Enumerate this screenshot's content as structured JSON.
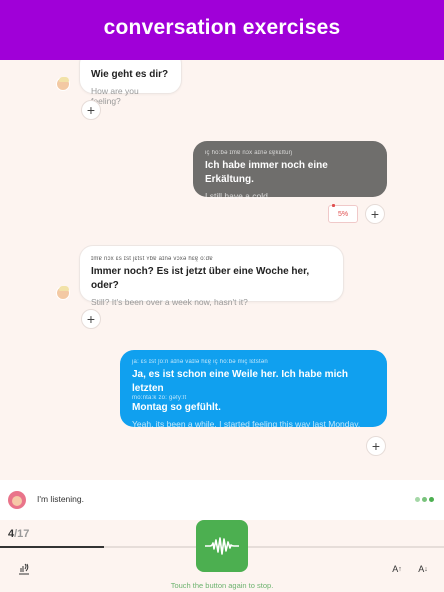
{
  "header": {
    "title": "conversation exercises"
  },
  "messages": [
    {
      "role": "partner",
      "ipa": "",
      "de": "Wie geht es dir?",
      "en": "How are you feeling?"
    },
    {
      "role": "user",
      "ipa": "iç   ho:bə       ɪmɐ       nɔx      aɪnə       ɛɐ̯kɛltuŋ",
      "de": "Ich habe immer noch eine Erkältung.",
      "en": "I still have a cold.",
      "score": "5%"
    },
    {
      "role": "partner",
      "ipa": "ɪmɐ       nɔx    ɛs   ɪst   jɛtst    ʏbɐ    aɪnə     vɔxə     hɛɐ̯      o:dɐ",
      "de": "Immer noch? Es ist jetzt über eine Woche her, oder?",
      "en": "Still? It's been over a week now, hasn't it?"
    },
    {
      "role": "current",
      "ipa": "ja:    ɛs    ɪst     ʃo:n     aɪnə    vaɪlə    hɛɐ̯   iç    ho:bə    miç      lɛtstən",
      "de_line1": "Ja, es ist schon eine Weile her. Ich habe mich letzten",
      "de_line2": "Montag so gefühlt.",
      "ipa2": "mo:nta:k   zo:     gəfy:lt",
      "en": "Yeah, its been a while. I started feeling this way last Monday."
    }
  ],
  "icons": {
    "add": "+",
    "add_name": "add-icon"
  },
  "status": {
    "listening": "I'm listening."
  },
  "progress": {
    "current": "4",
    "total": "/17",
    "fraction": 0.235
  },
  "hint": "Touch the button again to stop.",
  "toolbar": {
    "font_up": "A",
    "font_down": "A"
  },
  "colors": {
    "header": "#a000d8",
    "user_bubble": "#6f6e6c",
    "current_bubble": "#10a0ef",
    "mic": "#4caf50"
  }
}
